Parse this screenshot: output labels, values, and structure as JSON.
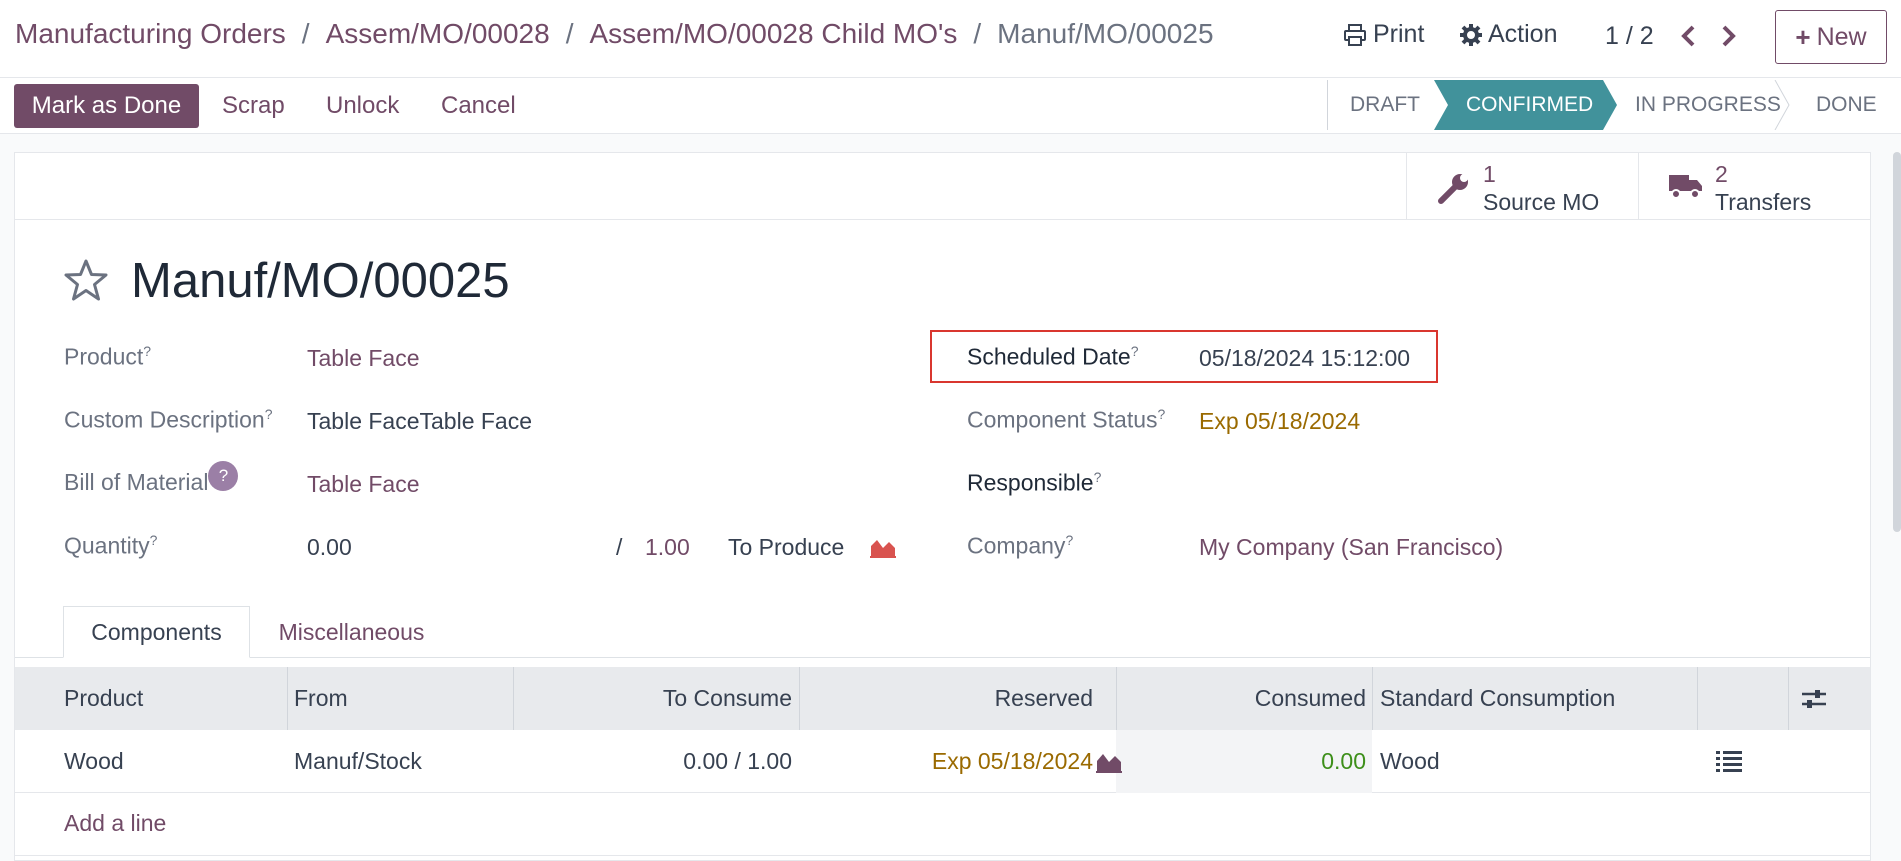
{
  "breadcrumb": {
    "items": [
      "Manufacturing Orders",
      "Assem/MO/00028",
      "Assem/MO/00028 Child MO's"
    ],
    "current": "Manuf/MO/00025",
    "separator": "/"
  },
  "top_actions": {
    "print_label": "Print",
    "action_label": "Action",
    "pager": "1 / 2",
    "new_label": "New"
  },
  "action_buttons": {
    "mark_done": "Mark as Done",
    "scrap": "Scrap",
    "unlock": "Unlock",
    "cancel": "Cancel"
  },
  "statusbar": {
    "stages": [
      "DRAFT",
      "CONFIRMED",
      "IN PROGRESS",
      "DONE"
    ],
    "active": "CONFIRMED",
    "active_color": "#41929b"
  },
  "smart_buttons": {
    "source_mo": {
      "count": "1",
      "label": "Source MO"
    },
    "transfers": {
      "count": "2",
      "label": "Transfers"
    }
  },
  "record": {
    "title": "Manuf/MO/00025"
  },
  "fields": {
    "product": {
      "label": "Product",
      "value": "Table Face"
    },
    "custom_description": {
      "label": "Custom Description",
      "value": "Table FaceTable Face"
    },
    "bill_of_material": {
      "label": "Bill of Material",
      "value": "Table Face"
    },
    "quantity": {
      "label": "Quantity",
      "produced": "0.00",
      "slash": "/",
      "to_produce_qty": "1.00",
      "to_produce_label": "To Produce"
    },
    "scheduled_date": {
      "label": "Scheduled Date",
      "value": "05/18/2024 15:12:00"
    },
    "component_status": {
      "label": "Component Status",
      "value": "Exp 05/18/2024"
    },
    "responsible": {
      "label": "Responsible",
      "value": ""
    },
    "company": {
      "label": "Company",
      "value": "My Company (San Francisco)"
    },
    "help_mark": "?"
  },
  "tabs": {
    "components": "Components",
    "miscellaneous": "Miscellaneous"
  },
  "table": {
    "headers": [
      "Product",
      "From",
      "To Consume",
      "Reserved",
      "Consumed",
      "Standard Consumption"
    ],
    "rows": [
      {
        "product": "Wood",
        "from": "Manuf/Stock",
        "to_consume": "0.00 / 1.00",
        "reserved": "Exp 05/18/2024",
        "consumed": "0.00",
        "standard": "Wood"
      }
    ],
    "add_line": "Add a line"
  },
  "colors": {
    "brand": "#714B67",
    "warning": "#9a6a00",
    "success": "#3d8f1a",
    "highlight": "#d9362f"
  }
}
